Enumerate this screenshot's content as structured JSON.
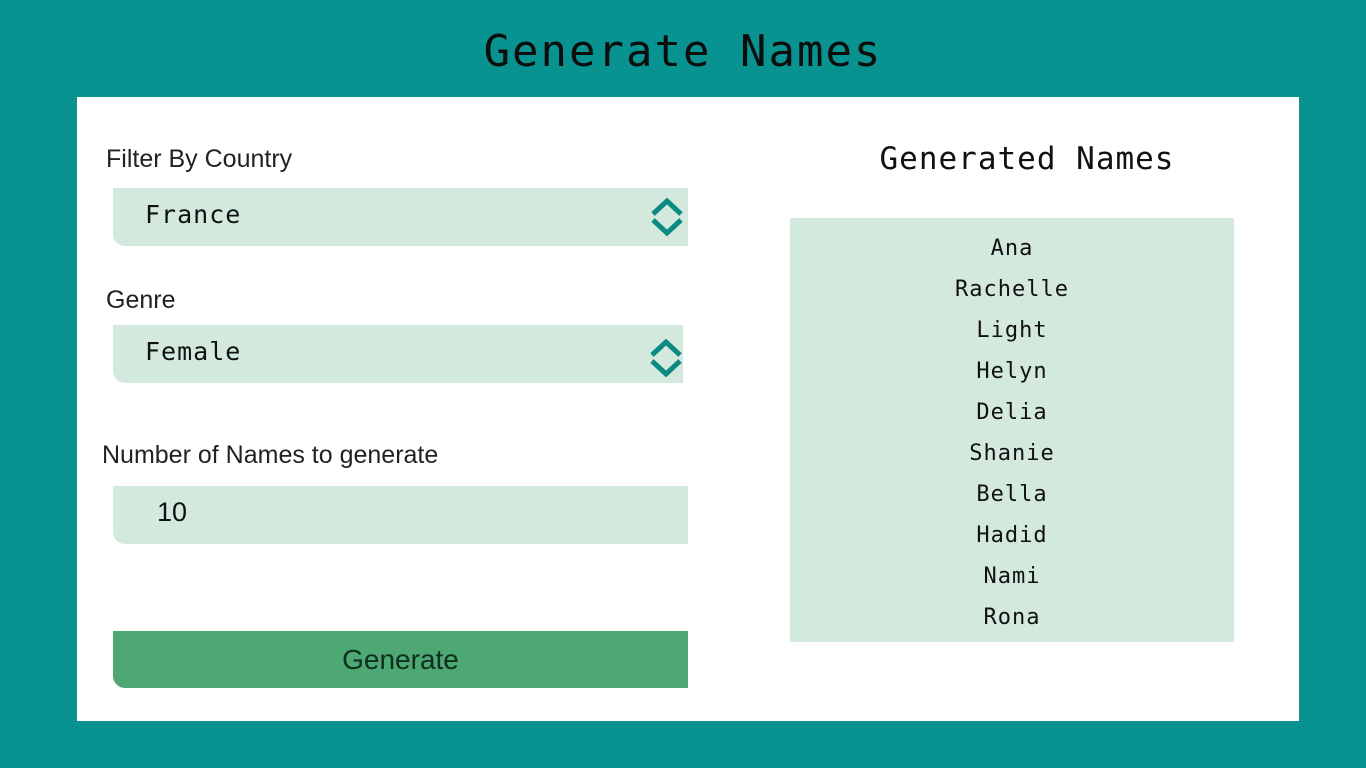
{
  "title": "Generate Names",
  "filters": {
    "country_label": "Filter By Country",
    "country_value": "France",
    "genre_label": "Genre",
    "genre_value": "Female",
    "count_label": "Number of Names to generate",
    "count_value": "10"
  },
  "generate_button": "Generate",
  "results": {
    "title": "Generated Names",
    "names": [
      "Ana",
      "Rachelle",
      "Light",
      "Helyn",
      "Delia",
      "Shanie",
      "Bella",
      "Hadid",
      "Nami",
      "Rona"
    ]
  },
  "colors": {
    "background": "#089390",
    "field": "#d3e9de",
    "button": "#4ea874",
    "chevron": "#0a8a80"
  },
  "icons": {
    "select_arrow": "chevron-up-down-icon"
  }
}
